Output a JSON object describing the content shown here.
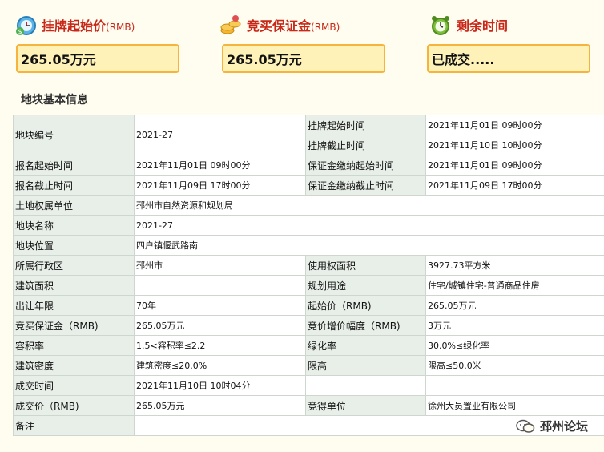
{
  "header": {
    "start_price_label": "挂牌起始价",
    "start_price_unit": "(RMB)",
    "deposit_label": "竞买保证金",
    "deposit_unit": "(RMB)",
    "remaining_label": "剩余时间",
    "start_price_value": "265.05万元",
    "deposit_value": "265.05万元",
    "remaining_value": "已成交....."
  },
  "section_title": "地块基本信息",
  "rows": [
    {
      "k1": "地块编号",
      "v1": "2021-27",
      "k2": "挂牌起始时间",
      "v2": "2021年11月01日 09时00分"
    },
    {
      "k2": "挂牌截止时间",
      "v2": "2021年11月10日 10时00分"
    },
    {
      "k1": "报名起始时间",
      "v1": "2021年11月01日 09时00分",
      "k2": "保证金缴纳起始时间",
      "v2": "2021年11月01日 09时00分"
    },
    {
      "k1": "报名截止时间",
      "v1": "2021年11月09日 17时00分",
      "k2": "保证金缴纳截止时间",
      "v2": "2021年11月09日 17时00分"
    },
    {
      "k1": "土地权属单位",
      "v1": "邳州市自然资源和规划局"
    },
    {
      "k1": "地块名称",
      "v1": "2021-27"
    },
    {
      "k1": "地块位置",
      "v1": "四户镇偃武路南"
    },
    {
      "k1": "所属行政区",
      "v1": "邳州市",
      "k2": "使用权面积",
      "v2": "3927.73平方米"
    },
    {
      "k1": "建筑面积",
      "v1": "",
      "k2": "规划用途",
      "v2": "住宅/城镇住宅-普通商品住房"
    },
    {
      "k1": "出让年限",
      "v1": "70年",
      "k2": "起始价（RMB)",
      "v2": "265.05万元"
    },
    {
      "k1": "竞买保证金（RMB)",
      "v1": "265.05万元",
      "k2": "竞价增价幅度（RMB)",
      "v2": "3万元"
    },
    {
      "k1": "容积率",
      "v1": "1.5<容积率≤2.2",
      "k2": "绿化率",
      "v2": "30.0%≤绿化率"
    },
    {
      "k1": "建筑密度",
      "v1": "建筑密度≤20.0%",
      "k2": "限高",
      "v2": "限高≤50.0米"
    },
    {
      "k1": "成交时间",
      "v1": "2021年11月10日 10时04分",
      "k2": "",
      "v2": ""
    },
    {
      "k1": "成交价（RMB)",
      "v1": "265.05万元",
      "k2": "竞得单位",
      "v2": "徐州大员置业有限公司"
    },
    {
      "k1": "备注",
      "v1": ""
    }
  ],
  "watermark": "邳州论坛",
  "icons": [
    "stopwatch-icon",
    "coins-icon",
    "alarm-clock-icon",
    "wechat-icon"
  ]
}
